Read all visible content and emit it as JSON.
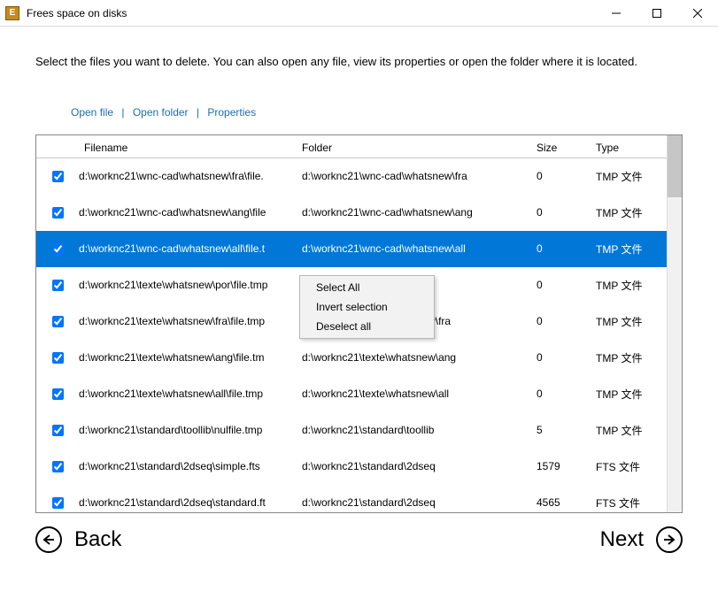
{
  "window": {
    "title": "Frees space on disks"
  },
  "instruction": "Select the files you want to delete. You can also open any file, view its properties or open the folder where it is located.",
  "links": {
    "open_file": "Open file",
    "open_folder": "Open folder",
    "properties": "Properties"
  },
  "columns": {
    "filename": "Filename",
    "folder": "Folder",
    "size": "Size",
    "type": "Type"
  },
  "rows": [
    {
      "checked": true,
      "filename": "d:\\worknc21\\wnc-cad\\whatsnew\\fra\\file.",
      "folder": "d:\\worknc21\\wnc-cad\\whatsnew\\fra",
      "size": "0",
      "type": "TMP 文件",
      "selected": false
    },
    {
      "checked": true,
      "filename": "d:\\worknc21\\wnc-cad\\whatsnew\\ang\\file",
      "folder": "d:\\worknc21\\wnc-cad\\whatsnew\\ang",
      "size": "0",
      "type": "TMP 文件",
      "selected": false
    },
    {
      "checked": true,
      "filename": "d:\\worknc21\\wnc-cad\\whatsnew\\all\\file.t",
      "folder": "d:\\worknc21\\wnc-cad\\whatsnew\\all",
      "size": "0",
      "type": "TMP 文件",
      "selected": true
    },
    {
      "checked": true,
      "filename": "d:\\worknc21\\texte\\whatsnew\\por\\file.tmp",
      "folder": "",
      "size": "0",
      "type": "TMP 文件",
      "selected": false
    },
    {
      "checked": true,
      "filename": "d:\\worknc21\\texte\\whatsnew\\fra\\file.tmp",
      "folder": "d:\\worknc21\\texte\\whatsnew\\fra",
      "size": "0",
      "type": "TMP 文件",
      "selected": false
    },
    {
      "checked": true,
      "filename": "d:\\worknc21\\texte\\whatsnew\\ang\\file.tm",
      "folder": "d:\\worknc21\\texte\\whatsnew\\ang",
      "size": "0",
      "type": "TMP 文件",
      "selected": false
    },
    {
      "checked": true,
      "filename": "d:\\worknc21\\texte\\whatsnew\\all\\file.tmp",
      "folder": "d:\\worknc21\\texte\\whatsnew\\all",
      "size": "0",
      "type": "TMP 文件",
      "selected": false
    },
    {
      "checked": true,
      "filename": "d:\\worknc21\\standard\\toollib\\nulfile.tmp",
      "folder": "d:\\worknc21\\standard\\toollib",
      "size": "5",
      "type": "TMP 文件",
      "selected": false
    },
    {
      "checked": true,
      "filename": "d:\\worknc21\\standard\\2dseq\\simple.fts",
      "folder": "d:\\worknc21\\standard\\2dseq",
      "size": "1579",
      "type": "FTS 文件",
      "selected": false
    },
    {
      "checked": true,
      "filename": "d:\\worknc21\\standard\\2dseq\\standard.ft",
      "folder": "d:\\worknc21\\standard\\2dseq",
      "size": "4565",
      "type": "FTS 文件",
      "selected": false
    }
  ],
  "context_menu": {
    "select_all": "Select All",
    "invert": "Invert selection",
    "deselect": "Deselect all"
  },
  "footer": {
    "back": "Back",
    "next": "Next"
  }
}
